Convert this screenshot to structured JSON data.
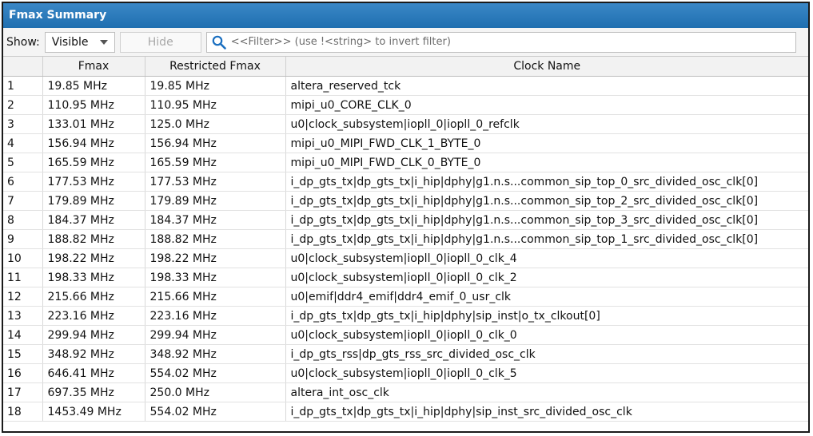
{
  "panel": {
    "title": "Fmax Summary"
  },
  "toolbar": {
    "show_label": "Show:",
    "show_value": "Visible",
    "hide_label": "Hide",
    "filter_placeholder": "<<Filter>> (use !<string> to invert filter)"
  },
  "table": {
    "columns": [
      "",
      "Fmax",
      "Restricted Fmax",
      "Clock Name"
    ],
    "rows": [
      {
        "idx": "1",
        "fmax": "19.85 MHz",
        "restricted": "19.85 MHz",
        "clock": "altera_reserved_tck"
      },
      {
        "idx": "2",
        "fmax": "110.95 MHz",
        "restricted": "110.95 MHz",
        "clock": "mipi_u0_CORE_CLK_0"
      },
      {
        "idx": "3",
        "fmax": "133.01 MHz",
        "restricted": "125.0 MHz",
        "clock": "u0|clock_subsystem|iopll_0|iopll_0_refclk"
      },
      {
        "idx": "4",
        "fmax": "156.94 MHz",
        "restricted": "156.94 MHz",
        "clock": "mipi_u0_MIPI_FWD_CLK_1_BYTE_0"
      },
      {
        "idx": "5",
        "fmax": "165.59 MHz",
        "restricted": "165.59 MHz",
        "clock": "mipi_u0_MIPI_FWD_CLK_0_BYTE_0"
      },
      {
        "idx": "6",
        "fmax": "177.53 MHz",
        "restricted": "177.53 MHz",
        "clock": "i_dp_gts_tx|dp_gts_tx|i_hip|dphy|g1.n.s...common_sip_top_0_src_divided_osc_clk[0]"
      },
      {
        "idx": "7",
        "fmax": "179.89 MHz",
        "restricted": "179.89 MHz",
        "clock": "i_dp_gts_tx|dp_gts_tx|i_hip|dphy|g1.n.s...common_sip_top_2_src_divided_osc_clk[0]"
      },
      {
        "idx": "8",
        "fmax": "184.37 MHz",
        "restricted": "184.37 MHz",
        "clock": "i_dp_gts_tx|dp_gts_tx|i_hip|dphy|g1.n.s...common_sip_top_3_src_divided_osc_clk[0]"
      },
      {
        "idx": "9",
        "fmax": "188.82 MHz",
        "restricted": "188.82 MHz",
        "clock": "i_dp_gts_tx|dp_gts_tx|i_hip|dphy|g1.n.s...common_sip_top_1_src_divided_osc_clk[0]"
      },
      {
        "idx": "10",
        "fmax": "198.22 MHz",
        "restricted": "198.22 MHz",
        "clock": "u0|clock_subsystem|iopll_0|iopll_0_clk_4"
      },
      {
        "idx": "11",
        "fmax": "198.33 MHz",
        "restricted": "198.33 MHz",
        "clock": "u0|clock_subsystem|iopll_0|iopll_0_clk_2"
      },
      {
        "idx": "12",
        "fmax": "215.66 MHz",
        "restricted": "215.66 MHz",
        "clock": "u0|emif|ddr4_emif|ddr4_emif_0_usr_clk"
      },
      {
        "idx": "13",
        "fmax": "223.16 MHz",
        "restricted": "223.16 MHz",
        "clock": "i_dp_gts_tx|dp_gts_tx|i_hip|dphy|sip_inst|o_tx_clkout[0]"
      },
      {
        "idx": "14",
        "fmax": "299.94 MHz",
        "restricted": "299.94 MHz",
        "clock": "u0|clock_subsystem|iopll_0|iopll_0_clk_0"
      },
      {
        "idx": "15",
        "fmax": "348.92 MHz",
        "restricted": "348.92 MHz",
        "clock": "i_dp_gts_rss|dp_gts_rss_src_divided_osc_clk"
      },
      {
        "idx": "16",
        "fmax": "646.41 MHz",
        "restricted": "554.02 MHz",
        "clock": "u0|clock_subsystem|iopll_0|iopll_0_clk_5"
      },
      {
        "idx": "17",
        "fmax": "697.35 MHz",
        "restricted": "250.0 MHz",
        "clock": "altera_int_osc_clk"
      },
      {
        "idx": "18",
        "fmax": "1453.49 MHz",
        "restricted": "554.02 MHz",
        "clock": "i_dp_gts_tx|dp_gts_tx|i_hip|dphy|sip_inst_src_divided_osc_clk"
      }
    ]
  },
  "colors": {
    "title_bar": "#2878bb",
    "search_icon": "#1a6fc0"
  }
}
